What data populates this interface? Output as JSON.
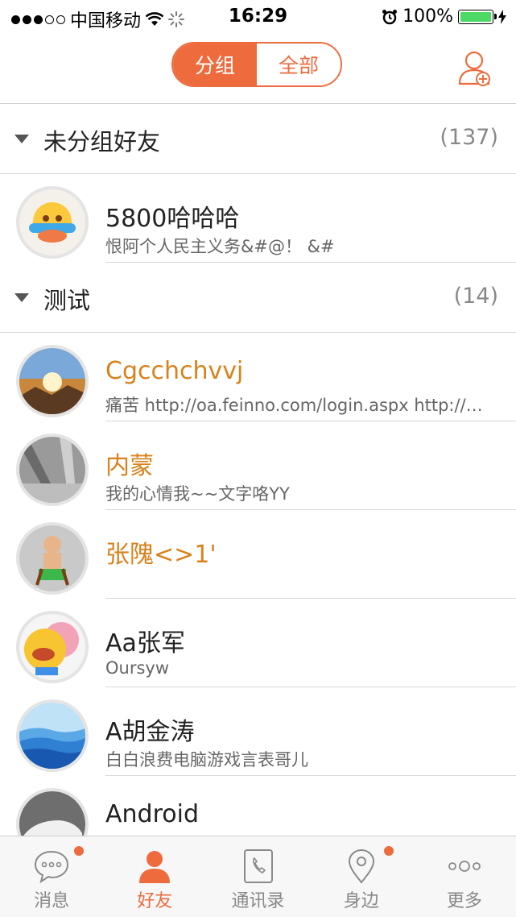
{
  "status_bar": {
    "carrier": "中国移动",
    "time": "16:29",
    "battery": "100%"
  },
  "header": {
    "segment_grouped": "分组",
    "segment_all": "全部",
    "add_friend_icon": "add-contact-icon"
  },
  "groups": [
    {
      "name": "未分组好友",
      "count": "(137)"
    },
    {
      "name": "测试",
      "count": "(14)"
    }
  ],
  "contacts": [
    {
      "name": "5800哈哈哈",
      "signature": "恨阿个人民主义务&#@！ &#",
      "name_color": "#222222"
    },
    {
      "name": "Cgcchchvvj",
      "signature": "痛苦 http://oa.feinno.com/login.aspx  http://oa.feinno.com",
      "name_color": "#d9821c"
    },
    {
      "name": "内蒙",
      "signature": "我的心情我~~文字咯YY",
      "name_color": "#d9821c"
    },
    {
      "name": "张隗<>1'",
      "signature": "",
      "name_color": "#d9821c"
    },
    {
      "name": "Aa张军",
      "signature": "Oursyw",
      "name_color": "#222222"
    },
    {
      "name": "A胡金涛",
      "signature": "白白浪费电脑游戏言表哥儿",
      "name_color": "#222222"
    },
    {
      "name": "Android",
      "signature": "",
      "name_color": "#222222"
    }
  ],
  "tabs": [
    {
      "label": "消息",
      "icon": "chat-bubble-icon",
      "badge": true
    },
    {
      "label": "好友",
      "icon": "person-icon",
      "active": true
    },
    {
      "label": "通讯录",
      "icon": "phone-book-icon"
    },
    {
      "label": "身边",
      "icon": "location-pin-icon",
      "badge": true
    },
    {
      "label": "更多",
      "icon": "more-dots-icon"
    }
  ],
  "colors": {
    "accent": "#ee6b3e",
    "orange_name": "#d9821c"
  }
}
